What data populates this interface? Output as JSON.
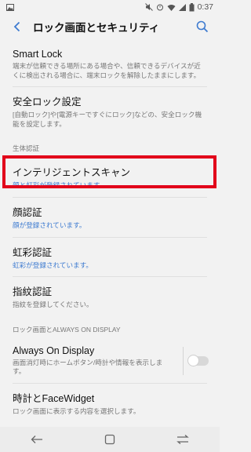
{
  "status": {
    "time": "0:37",
    "battery": "100",
    "icons": [
      "gallery-icon",
      "mute-icon",
      "alarm-icon",
      "wifi-icon",
      "signal-icon",
      "battery-icon"
    ]
  },
  "header": {
    "title": "ロック画面とセキュリティ",
    "back_icon": "chevron-left-icon",
    "search_icon": "search-icon"
  },
  "items": {
    "smart_lock": {
      "label": "Smart Lock",
      "sub": "端末が信頼できる場所にある場合や、信頼できるデバイスが近くに検出される場合に、端末ロックを解除したままにします。"
    },
    "secure_lock": {
      "label": "安全ロック設定",
      "sub": "[自動ロック]や[電源キーですぐにロック]などの、安全ロック機能を設定します。"
    },
    "biometrics_section": "生体認証",
    "intelligent_scan": {
      "label": "インテリジェントスキャン",
      "sub": "顔と虹彩が登録されています。"
    },
    "face": {
      "label": "顔認証",
      "sub": "顔が登録されています。"
    },
    "iris": {
      "label": "虹彩認証",
      "sub": "虹彩が登録されています。"
    },
    "fingerprint": {
      "label": "指紋認証",
      "sub": "指紋を登録してください。"
    },
    "lock_section": "ロック画面とALWAYS ON DISPLAY",
    "aod": {
      "label": "Always On Display",
      "sub": "画面消灯時にホームボタン/時計や情報を表示します。",
      "enabled": false
    },
    "clock": {
      "label": "時計とFaceWidget",
      "sub": "ロック画面に表示する内容を選択します。"
    }
  },
  "navbar": {
    "back": "back-arrow-icon",
    "home": "home-square-icon",
    "recents": "recents-icon"
  },
  "colors": {
    "accent": "#3e7bd0",
    "highlight": "#e2001a",
    "background": "#f2f2f2"
  }
}
